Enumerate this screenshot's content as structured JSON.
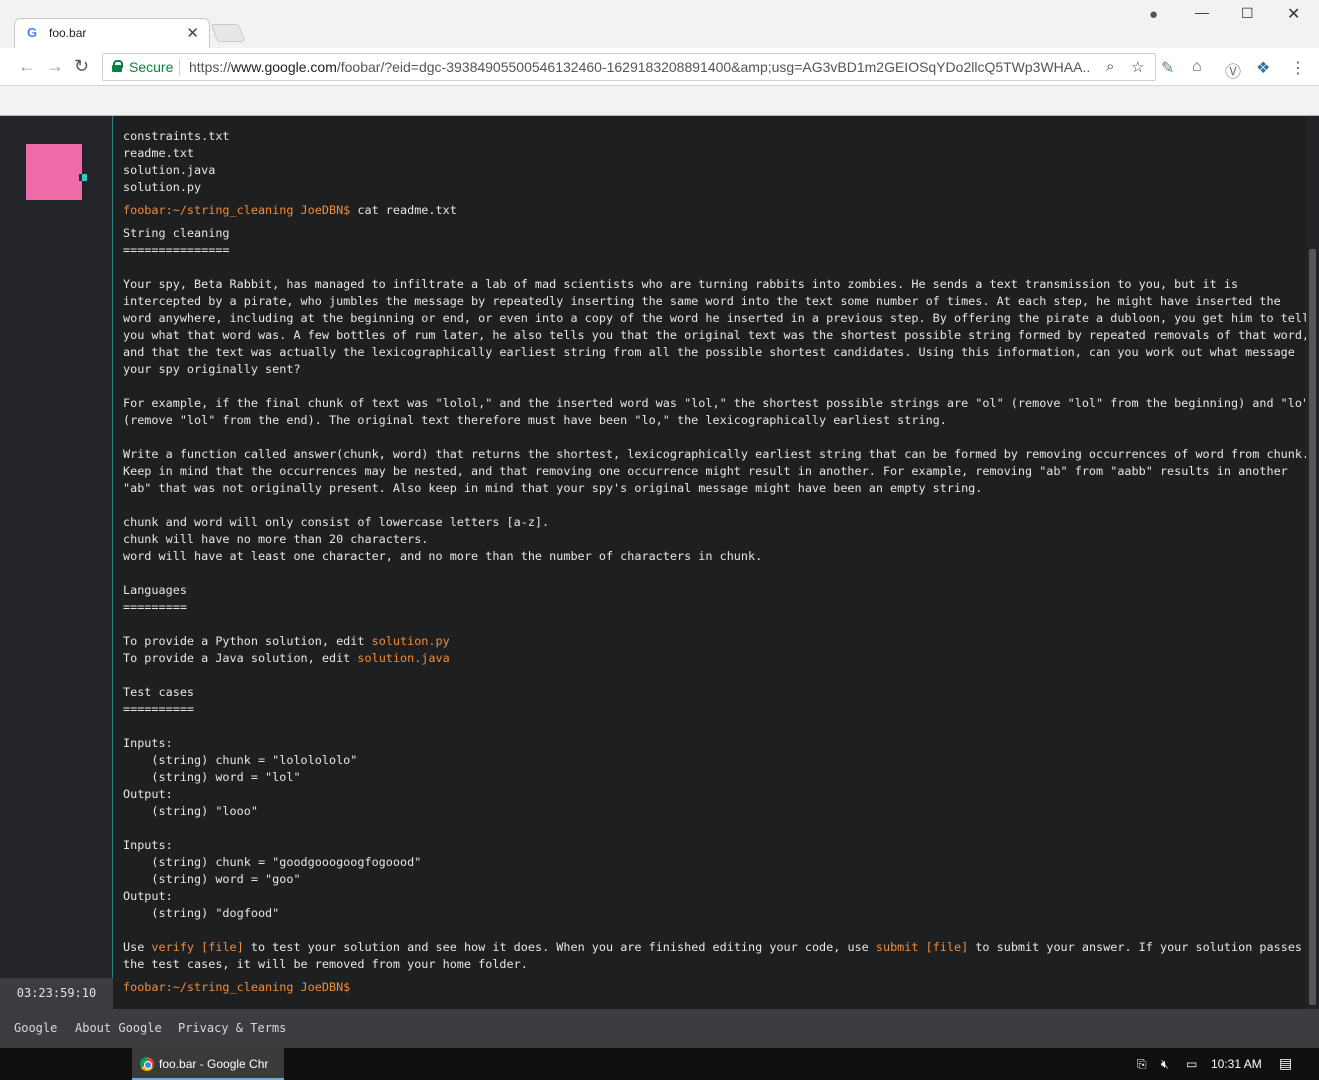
{
  "browser": {
    "tab_title": "foo.bar",
    "secure_label": "Secure",
    "url_scheme": "https://",
    "url_host": "www.google.com",
    "url_rest": "/foobar/?eid=dgc-39384905500546132460-1629183208891400&amp;usg=AG3vBD1m2GEIOSqYDo2llcQ5TWp3WHAA..."
  },
  "sidebar": {
    "timer": "03:23:59:10",
    "avatar_color": "#ef6aa9"
  },
  "terminal": {
    "files": [
      "constraints.txt",
      "readme.txt",
      "solution.java",
      "solution.py"
    ],
    "prompt": "foobar:~/string_cleaning JoeDBN$",
    "command": " cat readme.txt",
    "title": "String cleaning",
    "title_underline": "===============",
    "intro": [
      "Your spy, Beta Rabbit, has managed to infiltrate a lab of mad scientists who are turning rabbits into zombies. He sends a text transmission to you, but it is",
      "intercepted by a pirate, who jumbles the message by repeatedly inserting the same word into the text some number of times. At each step, he might have inserted the",
      "word anywhere, including at the beginning or end, or even into a copy of the word he inserted in a previous step. By offering the pirate a dubloon, you get him to tell",
      "you what that word was. A few bottles of rum later, he also tells you that the original text was the shortest possible string formed by repeated removals of that word,",
      "and that the text was actually the lexicographically earliest string from all the possible shortest candidates. Using this information, can you work out what message",
      "your spy originally sent?"
    ],
    "example": [
      "For example, if the final chunk of text was \"lolol,\" and the inserted word was \"lol,\" the shortest possible strings are \"ol\" (remove \"lol\" from the beginning) and \"lo\"",
      "(remove \"lol\" from the end). The original text therefore must have been \"lo,\" the lexicographically earliest string."
    ],
    "task": [
      "Write a function called answer(chunk, word) that returns the shortest, lexicographically earliest string that can be formed by removing occurrences of word from chunk.",
      "Keep in mind that the occurrences may be nested, and that removing one occurrence might result in another. For example, removing \"ab\" from \"aabb\" results in another",
      "\"ab\" that was not originally present. Also keep in mind that your spy's original message might have been an empty string."
    ],
    "constraints": [
      "chunk and word will only consist of lowercase letters [a-z].",
      "chunk will have no more than 20 characters.",
      "word will have at least one character, and no more than the number of characters in chunk."
    ],
    "languages_title": "Languages",
    "languages_underline": "=========",
    "python_prefix": "To provide a Python solution, edit ",
    "python_file": "solution.py",
    "java_prefix": "To provide a Java solution, edit ",
    "java_file": "solution.java",
    "tests_title": "Test cases",
    "tests_underline": "==========",
    "test1": {
      "inputs_label": "Inputs:",
      "chunk": "    (string) chunk = \"lololololo\"",
      "word": "    (string) word = \"lol\"",
      "output_label": "Output:",
      "output": "    (string) \"looo\""
    },
    "test2": {
      "inputs_label": "Inputs:",
      "chunk": "    (string) chunk = \"goodgooogoogfogoood\"",
      "word": "    (string) word = \"goo\"",
      "output_label": "Output:",
      "output": "    (string) \"dogfood\""
    },
    "closing_a": "Use ",
    "closing_verify": "verify [file]",
    "closing_b": " to test your solution and see how it does. When you are finished editing your code, use ",
    "closing_submit": "submit [file]",
    "closing_c": " to submit your answer. If your solution passes",
    "closing_line2": "the test cases, it will be removed from your home folder."
  },
  "footer": {
    "links": [
      "Google",
      "About Google",
      "Privacy & Terms"
    ]
  },
  "taskbar": {
    "task_label": "foo.bar - Google Chr",
    "time": "10:31 AM"
  }
}
